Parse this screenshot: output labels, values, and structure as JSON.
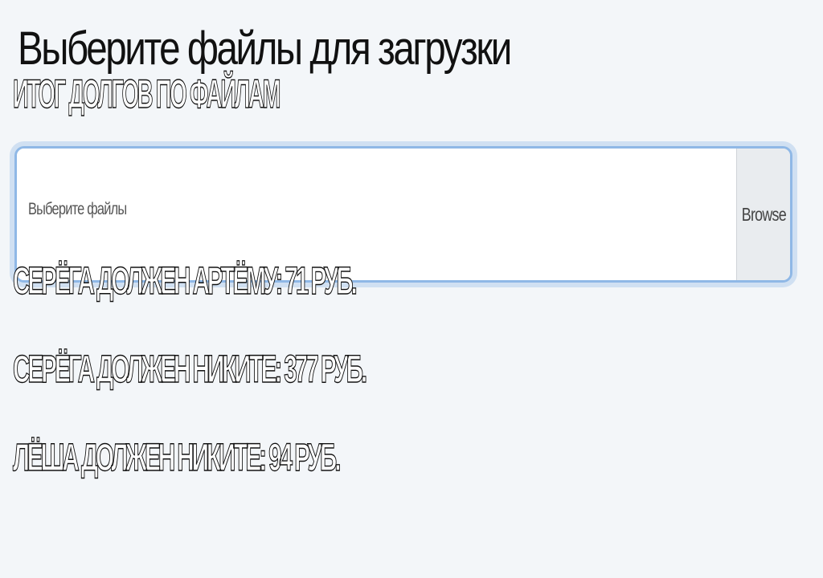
{
  "upload": {
    "title": "Выберите файлы для загрузки",
    "placeholder": "Выберите файлы",
    "browse_label": "Browse",
    "accent_color": "#8fb8e6"
  },
  "totals": {
    "title": "ИТОГ ДОЛГОВ ПО ФАЙЛАМ"
  },
  "debts": [
    {
      "text": "СЕРЁГА ДОЛЖЕН АРТЁМУ: 71 РУБ."
    },
    {
      "text": "СЕРЁГА ДОЛЖЕН НИКИТЕ: 377 РУБ."
    },
    {
      "text": "ЛЁША ДОЛЖЕН НИКИТЕ: 94 РУБ."
    }
  ]
}
